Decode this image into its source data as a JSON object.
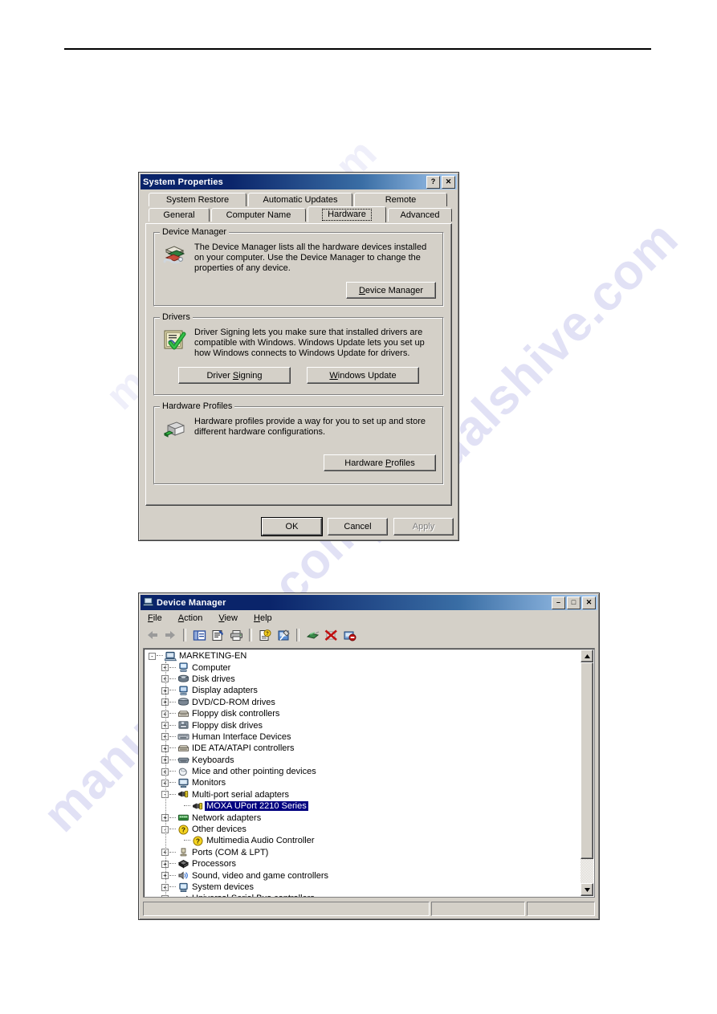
{
  "page": {
    "watermark": "manualshive.com"
  },
  "system_properties": {
    "title": "System Properties",
    "titlebar_buttons": [
      {
        "name": "help-button",
        "glyph": "?"
      },
      {
        "name": "close-button",
        "glyph": "✕"
      }
    ],
    "tabs_row1": [
      {
        "label": "System Restore",
        "selected": false
      },
      {
        "label": "Automatic Updates",
        "selected": false
      },
      {
        "label": "Remote",
        "selected": false
      }
    ],
    "tabs_row2": [
      {
        "label": "General",
        "selected": false
      },
      {
        "label": "Computer Name",
        "selected": false
      },
      {
        "label": "Hardware",
        "selected": true
      },
      {
        "label": "Advanced",
        "selected": false
      }
    ],
    "groups": {
      "device_manager": {
        "title": "Device Manager",
        "text": "The Device Manager lists all the hardware devices installed on your computer. Use the Device Manager to change the properties of any device.",
        "button": "Device Manager",
        "button_mnemonic": "D"
      },
      "drivers": {
        "title": "Drivers",
        "text": "Driver Signing lets you make sure that installed drivers are compatible with Windows. Windows Update lets you set up how Windows connects to Windows Update for drivers.",
        "button_signing": "Driver Signing",
        "button_signing_mnemonic": "S",
        "button_update": "Windows Update",
        "button_update_mnemonic": "W"
      },
      "hardware_profiles": {
        "title": "Hardware Profiles",
        "text": "Hardware profiles provide a way for you to set up and store different hardware configurations.",
        "button": "Hardware Profiles",
        "button_mnemonic": "P"
      }
    },
    "footer_buttons": [
      {
        "label": "OK",
        "state": "default"
      },
      {
        "label": "Cancel",
        "state": "normal"
      },
      {
        "label": "Apply",
        "state": "disabled",
        "mnemonic": "A"
      }
    ]
  },
  "device_manager": {
    "title": "Device Manager",
    "titlebar_buttons": [
      {
        "name": "minimize-button",
        "glyph": "–"
      },
      {
        "name": "maximize-button",
        "glyph": "□"
      },
      {
        "name": "close-button",
        "glyph": "✕"
      }
    ],
    "menu": [
      {
        "label": "File",
        "mnemonic": "F"
      },
      {
        "label": "Action",
        "mnemonic": "A"
      },
      {
        "label": "View",
        "mnemonic": "V"
      },
      {
        "label": "Help",
        "mnemonic": "H"
      }
    ],
    "toolbar": [
      {
        "name": "back-icon"
      },
      {
        "name": "forward-icon"
      },
      {
        "name": "separator"
      },
      {
        "name": "show-hide-console-tree-icon"
      },
      {
        "name": "properties-icon"
      },
      {
        "name": "print-icon"
      },
      {
        "name": "separator"
      },
      {
        "name": "help-icon"
      },
      {
        "name": "update-driver-icon"
      },
      {
        "name": "separator"
      },
      {
        "name": "scan-for-hardware-changes-icon"
      },
      {
        "name": "disable-device-icon"
      },
      {
        "name": "uninstall-device-icon"
      }
    ],
    "tree": [
      {
        "label": "MARKETING-EN",
        "level": 0,
        "expander": "-",
        "icon": "computer-node-icon",
        "selected": false
      },
      {
        "label": "Computer",
        "level": 1,
        "expander": "+",
        "icon": "computer-icon",
        "selected": false
      },
      {
        "label": "Disk drives",
        "level": 1,
        "expander": "+",
        "icon": "disk-drive-icon",
        "selected": false
      },
      {
        "label": "Display adapters",
        "level": 1,
        "expander": "+",
        "icon": "display-adapter-icon",
        "selected": false
      },
      {
        "label": "DVD/CD-ROM drives",
        "level": 1,
        "expander": "+",
        "icon": "cdrom-icon",
        "selected": false
      },
      {
        "label": "Floppy disk controllers",
        "level": 1,
        "expander": "+",
        "icon": "floppy-controller-icon",
        "selected": false
      },
      {
        "label": "Floppy disk drives",
        "level": 1,
        "expander": "+",
        "icon": "floppy-drive-icon",
        "selected": false
      },
      {
        "label": "Human Interface Devices",
        "level": 1,
        "expander": "+",
        "icon": "hid-icon",
        "selected": false
      },
      {
        "label": "IDE ATA/ATAPI controllers",
        "level": 1,
        "expander": "+",
        "icon": "ide-controller-icon",
        "selected": false
      },
      {
        "label": "Keyboards",
        "level": 1,
        "expander": "+",
        "icon": "keyboard-icon",
        "selected": false
      },
      {
        "label": "Mice and other pointing devices",
        "level": 1,
        "expander": "+",
        "icon": "mouse-icon",
        "selected": false
      },
      {
        "label": "Monitors",
        "level": 1,
        "expander": "+",
        "icon": "monitor-icon",
        "selected": false
      },
      {
        "label": "Multi-port serial adapters",
        "level": 1,
        "expander": "-",
        "icon": "serial-adapter-icon",
        "selected": false
      },
      {
        "label": "MOXA UPort 2210 Series",
        "level": 2,
        "expander": "",
        "icon": "serial-adapter-icon",
        "selected": true
      },
      {
        "label": "Network adapters",
        "level": 1,
        "expander": "+",
        "icon": "network-adapter-icon",
        "selected": false
      },
      {
        "label": "Other devices",
        "level": 1,
        "expander": "-",
        "icon": "other-device-icon",
        "selected": false
      },
      {
        "label": "Multimedia Audio Controller",
        "level": 2,
        "expander": "",
        "icon": "unknown-device-icon",
        "selected": false
      },
      {
        "label": "Ports (COM & LPT)",
        "level": 1,
        "expander": "+",
        "icon": "port-icon",
        "selected": false
      },
      {
        "label": "Processors",
        "level": 1,
        "expander": "+",
        "icon": "processor-icon",
        "selected": false
      },
      {
        "label": "Sound, video and game controllers",
        "level": 1,
        "expander": "+",
        "icon": "sound-icon",
        "selected": false
      },
      {
        "label": "System devices",
        "level": 1,
        "expander": "+",
        "icon": "system-device-icon",
        "selected": false
      },
      {
        "label": "Universal Serial Bus controllers",
        "level": 1,
        "expander": "+",
        "icon": "usb-icon",
        "selected": false
      }
    ],
    "statusbar": [
      "",
      "",
      ""
    ]
  },
  "colors": {
    "dialog_face": "#d4d0c8",
    "titlebar_start": "#0a246a",
    "titlebar_end": "#a6caf0",
    "selection": "#000080",
    "watermark": "#c9c9ee"
  }
}
